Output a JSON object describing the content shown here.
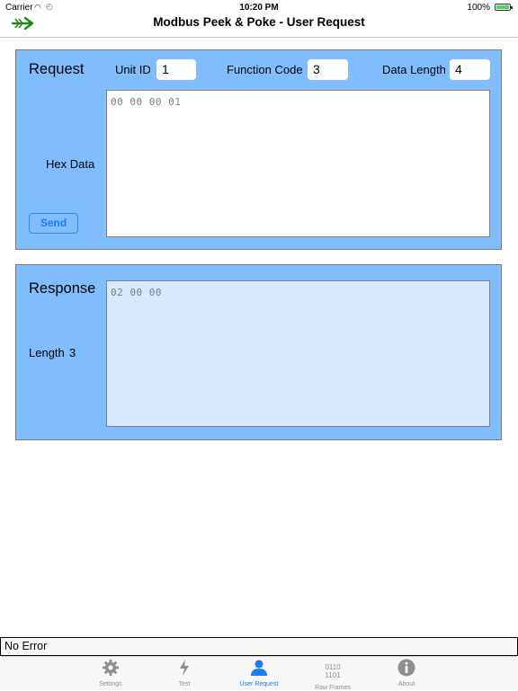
{
  "status_bar": {
    "carrier": "Carrier",
    "time": "10:20 PM",
    "battery_text": "100%",
    "battery_level": 1.0
  },
  "nav": {
    "title": "Modbus Peek & Poke - User Request",
    "logo_icon": "arrow-right-icon"
  },
  "request": {
    "heading": "Request",
    "unit_id_label": "Unit ID",
    "unit_id_value": "1",
    "function_code_label": "Function Code",
    "function_code_value": "3",
    "data_length_label": "Data Length",
    "data_length_value": "4",
    "hex_label": "Hex Data",
    "hex_value": "00 00 00 01",
    "send_label": "Send"
  },
  "response": {
    "heading": "Response",
    "length_label": "Length",
    "length_value": "3",
    "data": "02 00 00"
  },
  "status_message": "No Error",
  "tabs": [
    {
      "label": "Settings",
      "icon": "gear-icon"
    },
    {
      "label": "Test",
      "icon": "lightning-icon"
    },
    {
      "label": "User Request",
      "icon": "person-icon",
      "active": true
    },
    {
      "label": "Raw Frames",
      "icon": "binary-icon",
      "icon_text": [
        "0110",
        "1101"
      ]
    },
    {
      "label": "About",
      "icon": "info-icon"
    }
  ],
  "colors": {
    "panel_bg": "#80bdff",
    "response_area_bg": "#d6e9ff",
    "accent": "#1a7cf5",
    "logo_green": "#1a8a1a"
  }
}
